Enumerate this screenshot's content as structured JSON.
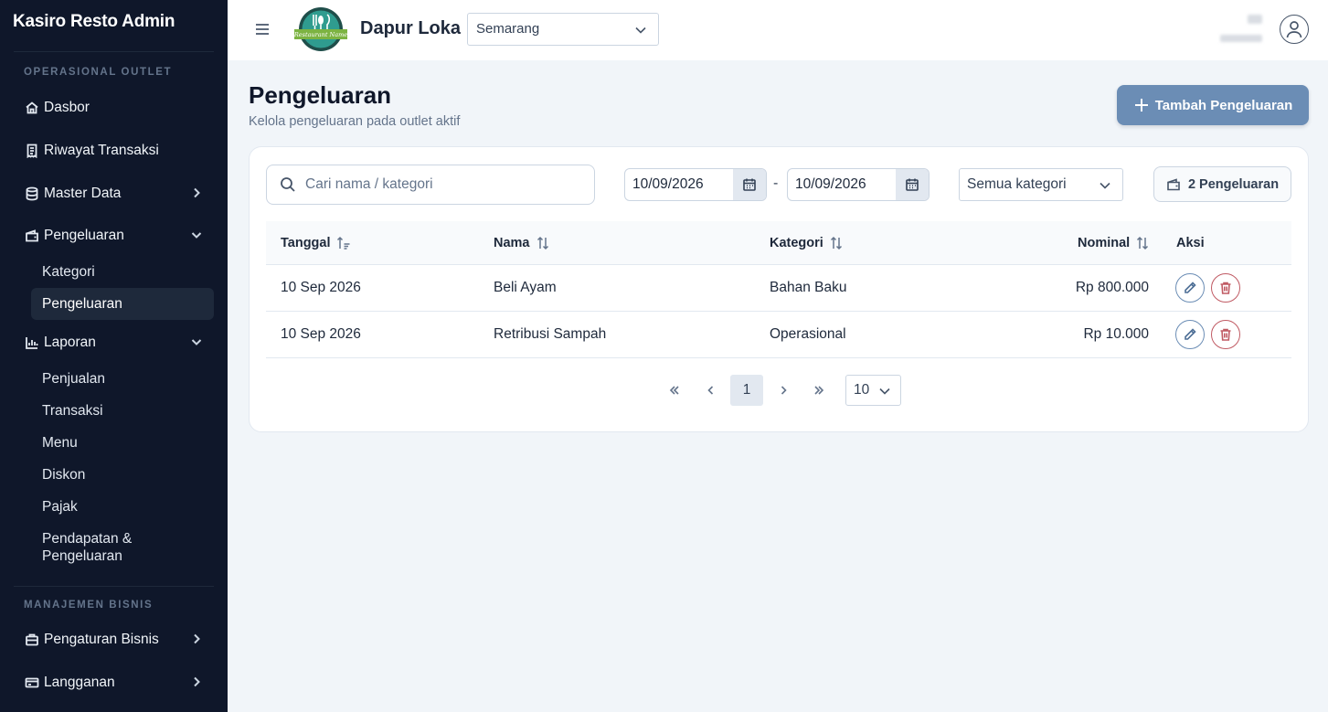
{
  "app": {
    "brand": "Kasiro Resto Admin"
  },
  "sidebar": {
    "sections": [
      {
        "label": "OPERASIONAL OUTLET"
      },
      {
        "label": "MANAJEMEN BISNIS"
      }
    ],
    "items": {
      "dasbor": {
        "label": "Dasbor",
        "icon": "home-icon"
      },
      "riwayat": {
        "label": "Riwayat Transaksi",
        "icon": "receipt-icon"
      },
      "master": {
        "label": "Master Data",
        "icon": "database-icon"
      },
      "pengeluaran": {
        "label": "Pengeluaran",
        "icon": "wallet-icon"
      },
      "laporan": {
        "label": "Laporan",
        "icon": "bar-chart-icon"
      },
      "pengaturan": {
        "label": "Pengaturan Bisnis",
        "icon": "briefcase-icon"
      },
      "langganan": {
        "label": "Langganan",
        "icon": "credit-card-icon"
      }
    },
    "pengeluaran_sub": [
      "Kategori",
      "Pengeluaran"
    ],
    "laporan_sub": [
      "Penjualan",
      "Transaksi",
      "Menu",
      "Diskon",
      "Pajak",
      "Pendapatan & Pengeluaran"
    ]
  },
  "topbar": {
    "outlet_name": "Dapur Loka",
    "outlet_select": "Semarang",
    "logo_text": "Restaurant Name"
  },
  "page": {
    "title": "Pengeluaran",
    "subtitle": "Kelola pengeluaran pada outlet aktif",
    "add_button": "Tambah Pengeluaran"
  },
  "filters": {
    "search_placeholder": "Cari nama / kategori",
    "date_from": "10/09/2026",
    "date_separator": "-",
    "date_to": "10/09/2026",
    "category": "Semua kategori",
    "count_label": "2 Pengeluaran"
  },
  "table": {
    "headers": {
      "tanggal": "Tanggal",
      "nama": "Nama",
      "kategori": "Kategori",
      "nominal": "Nominal",
      "aksi": "Aksi"
    },
    "rows": [
      {
        "tanggal": "10 Sep 2026",
        "nama": "Beli Ayam",
        "kategori": "Bahan Baku",
        "nominal": "Rp 800.000"
      },
      {
        "tanggal": "10 Sep 2026",
        "nama": "Retribusi Sampah",
        "kategori": "Operasional",
        "nominal": "Rp 10.000"
      }
    ]
  },
  "pagination": {
    "current_page": "1",
    "per_page": "10"
  },
  "colors": {
    "sidebar_bg": "#0f172a",
    "accent": "#6b8db5",
    "danger": "#c05a63"
  }
}
